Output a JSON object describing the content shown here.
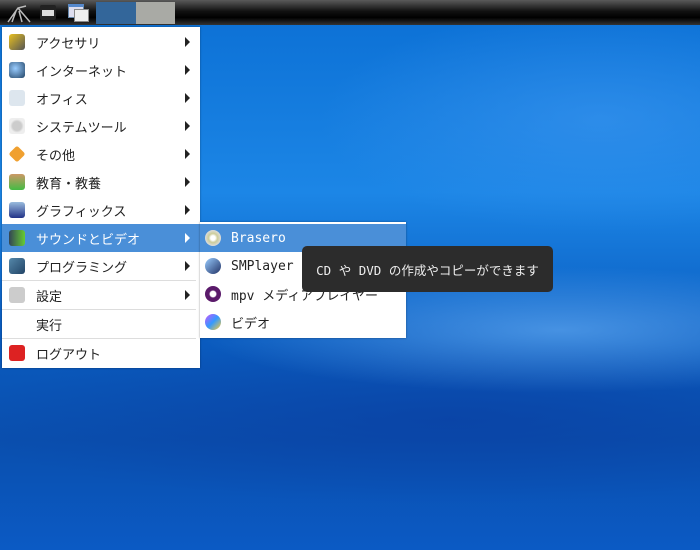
{
  "panel": {
    "buttons": [
      "app-menu",
      "file-manager",
      "show-desktop",
      "task-1",
      "task-2"
    ]
  },
  "menu": {
    "items": [
      {
        "label": "アクセサリ",
        "icon": "accessories-icon",
        "sub": true
      },
      {
        "label": "インターネット",
        "icon": "internet-globe-icon",
        "sub": true
      },
      {
        "label": "オフィス",
        "icon": "office-icon",
        "sub": true
      },
      {
        "label": "システムツール",
        "icon": "system-gear-icon",
        "sub": true
      },
      {
        "label": "その他",
        "icon": "other-diamond-icon",
        "sub": true
      },
      {
        "label": "教育・教養",
        "icon": "education-flask-icon",
        "sub": true
      },
      {
        "label": "グラフィックス",
        "icon": "graphics-icon",
        "sub": true
      },
      {
        "label": "サウンドとビデオ",
        "icon": "multimedia-icon",
        "sub": true,
        "active": true
      },
      {
        "label": "プログラミング",
        "icon": "programming-icon",
        "sub": true
      },
      {
        "label": "設定",
        "icon": "settings-icon",
        "sub": true
      },
      {
        "label": "実行",
        "icon": "",
        "sub": false
      },
      {
        "label": "ログアウト",
        "icon": "logout-power-icon",
        "sub": false
      }
    ]
  },
  "submenu": {
    "items": [
      {
        "label": "Brasero",
        "icon": "brasero-disc-icon",
        "active": true
      },
      {
        "label": "SMPlayer",
        "icon": "smplayer-icon"
      },
      {
        "label": "mpv メディアプレイヤー",
        "icon": "mpv-icon"
      },
      {
        "label": "ビデオ",
        "icon": "video-play-icon"
      }
    ]
  },
  "tooltip": "CD や DVD の作成やコピーができます",
  "colors": {
    "highlight": "#4a8fd8",
    "tooltip_bg": "#2c2c2c"
  }
}
